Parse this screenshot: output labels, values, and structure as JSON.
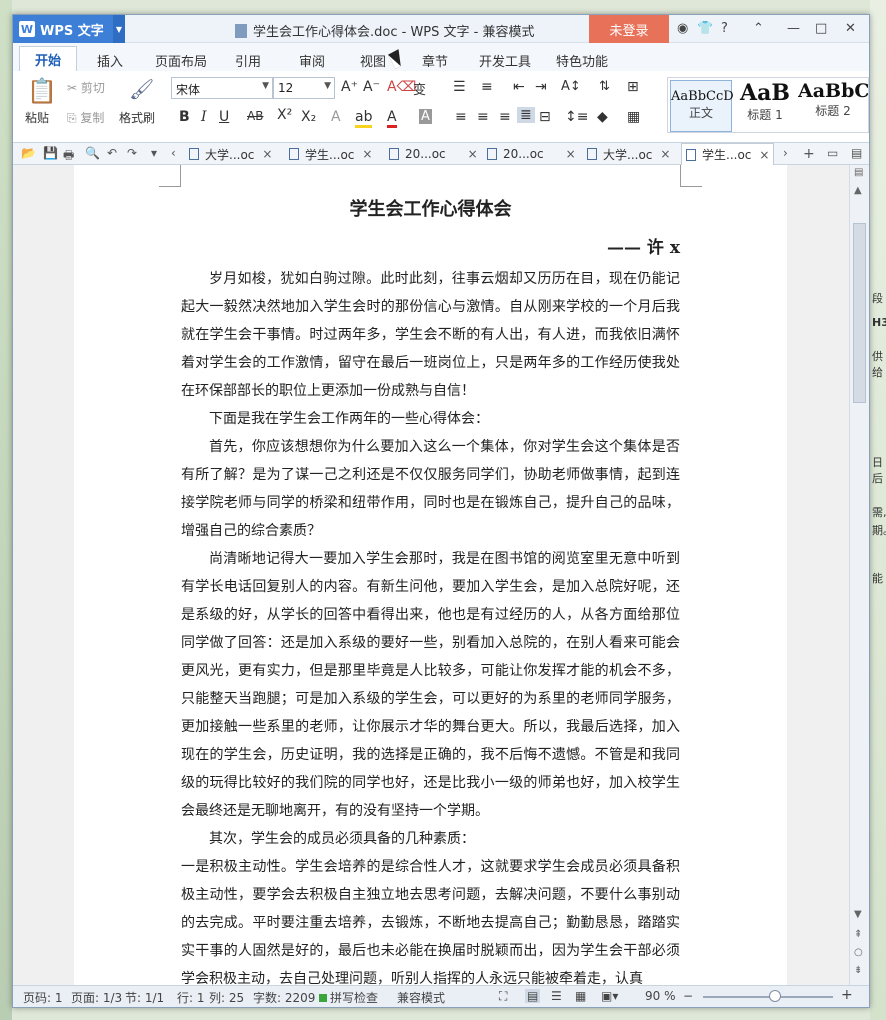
{
  "app": {
    "name": "WPS 文字",
    "title": "学生会工作心得体会.doc - WPS 文字 - 兼容模式",
    "login": "未登录"
  },
  "window_controls": {
    "shirt": "👕",
    "help": "?",
    "collapse": "⌃",
    "min": "—",
    "max": "□",
    "close": "✕"
  },
  "menu_tabs": [
    "开始",
    "插入",
    "页面布局",
    "引用",
    "审阅",
    "视图",
    "章节",
    "开发工具",
    "特色功能"
  ],
  "ribbon": {
    "paste": "粘贴",
    "cut": "剪切",
    "copy": "复制",
    "format_painter": "格式刷",
    "font": "宋体",
    "size": "12",
    "styles": [
      {
        "sample": "AaBbCcD",
        "label": "正文"
      },
      {
        "sample": "AaB",
        "label": "标题 1"
      },
      {
        "sample": "AaBbC",
        "label": "标题 2"
      }
    ]
  },
  "doc_tabs": [
    {
      "label": "大学...oc",
      "active": false
    },
    {
      "label": "学生...oc",
      "active": false
    },
    {
      "label": "20...oc",
      "active": false
    },
    {
      "label": "20...oc",
      "active": false
    },
    {
      "label": "大学...oc",
      "active": false
    },
    {
      "label": "学生...oc",
      "active": true
    }
  ],
  "document": {
    "title": "学生会工作心得体会",
    "author": "—— 许 x",
    "paragraphs": [
      "岁月如梭，犹如白驹过隙。此时此刻，往事云烟却又历历在目，现在仍能记起大一毅然决然地加入学生会时的那份信心与激情。自从刚来学校的一个月后我就在学生会干事情。时过两年多，学生会不断的有人出，有人进，而我依旧满怀着对学生会的工作激情，留守在最后一班岗位上，只是两年多的工作经历使我处在环保部部长的职位上更添加一份成熟与自信！",
      "下面是我在学生会工作两年的一些心得体会：",
      "首先，你应该想想你为什么要加入这么一个集体，你对学生会这个集体是否有所了解？是为了谋一己之利还是不仅仅服务同学们，协助老师做事情，起到连接学院老师与同学的桥梁和纽带作用，同时也是在锻炼自己，提升自己的品味，增强自己的综合素质？",
      "尚清晰地记得大一要加入学生会那时，我是在图书馆的阅览室里无意中听到有学长电话回复别人的内容。有新生问他，要加入学生会，是加入总院好呢，还是系级的好，从学长的回答中看得出来，他也是有过经历的人，从各方面给那位同学做了回答：还是加入系级的要好一些，别看加入总院的，在别人看来可能会更风光，更有实力，但是那里毕竟是人比较多，可能让你发挥才能的机会不多，只能整天当跑腿；可是加入系级的学生会，可以更好的为系里的老师同学服务，更加接触一些系里的老师，让你展示才华的舞台更大。所以，我最后选择，加入现在的学生会，历史证明，我的选择是正确的，我不后悔不遗憾。不管是和我同级的玩得比较好的我们院的同学也好，还是比我小一级的师弟也好，加入校学生会最终还是无聊地离开，有的没有坚持一个学期。",
      "其次，学生会的成员必须具备的几种素质：",
      "一是积极主动性。学生会培养的是综合性人才，这就要求学生会成员必须具备积极主动性，要学会去积极自主独立地去思考问题，去解决问题，不要什么事别动的去完成。平时要注重去培养，去锻炼，不断地去提高自己；勤勤恳恳，踏踏实实干事的人固然是好的，最后也未必能在换届时脱颖而出，因为学生会干部必须学会积极主动，去自己处理问题，听别人指挥的人永远只能被牵着走，认真"
    ]
  },
  "status": {
    "page_code": "页码: 1",
    "pages": "页面: 1/3",
    "section": "节: 1/1",
    "line": "行: 1",
    "col": "列: 25",
    "words": "字数: 2209",
    "spell": "拼写检查",
    "mode": "兼容模式",
    "zoom": "90 %",
    "zoom_value": 0.55
  },
  "desktop_fragments": [
    "段",
    "H3",
    "供给",
    "日后",
    "需,",
    "能",
    "期。"
  ]
}
